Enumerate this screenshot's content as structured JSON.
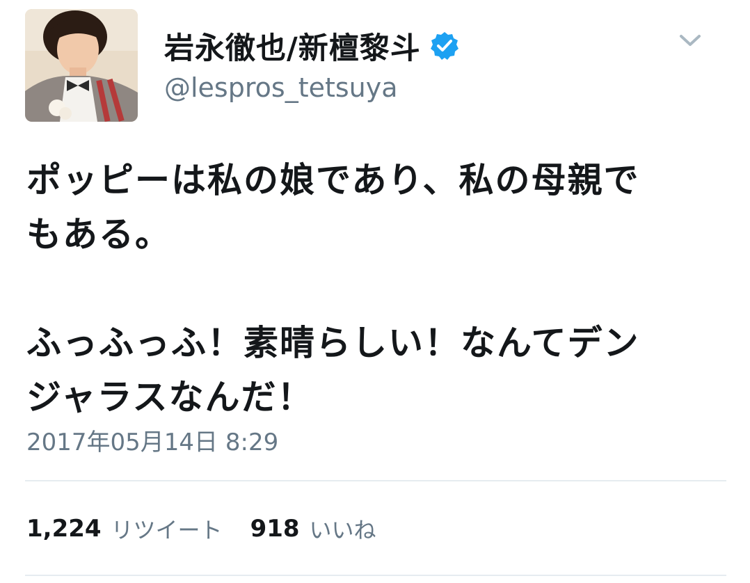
{
  "user": {
    "display_name": "岩永徹也/新檀黎斗",
    "handle": "@lespros_tetsuya",
    "verified": true
  },
  "icons": {
    "verified": "verified-badge-icon",
    "menu": "chevron-down-icon"
  },
  "colors": {
    "verified_blue": "#1da1f2",
    "text_primary": "#14171a",
    "text_secondary": "#657786",
    "divider": "#e6ecf0"
  },
  "tweet": {
    "lines": [
      "ポッピーは私の娘であり、私の母親で",
      "もある。",
      "",
      "ふっふっふ！素晴らしい！なんてデン",
      "ジャラスなんだ！"
    ],
    "timestamp": "2017年05月14日 8:29"
  },
  "stats": {
    "retweets_count": "1,224",
    "retweets_label": "リツイート",
    "likes_count": "918",
    "likes_label": "いいね"
  }
}
